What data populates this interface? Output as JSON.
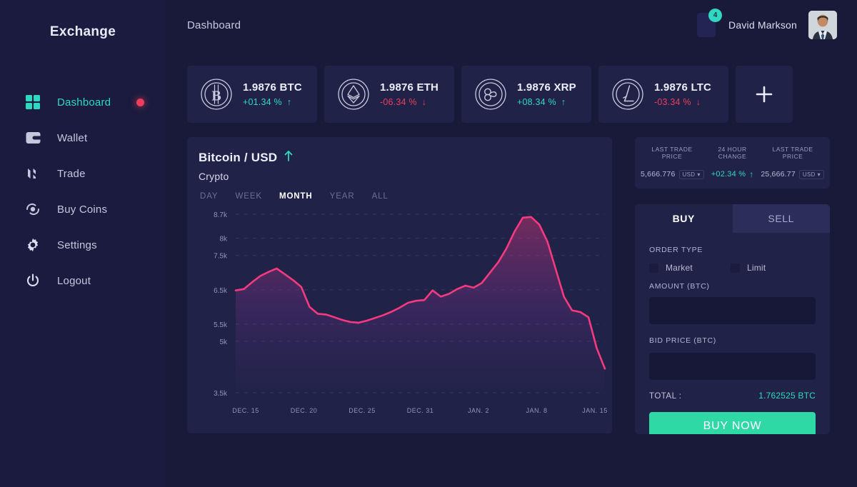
{
  "brand": "Exchange",
  "sidebar": {
    "items": [
      {
        "label": "Dashboard",
        "icon": "grid-icon",
        "active": true,
        "badge": true
      },
      {
        "label": "Wallet",
        "icon": "wallet-icon",
        "active": false,
        "badge": false
      },
      {
        "label": "Trade",
        "icon": "trade-icon",
        "active": false,
        "badge": false
      },
      {
        "label": "Buy Coins",
        "icon": "buy-coins-icon",
        "active": false,
        "badge": false
      },
      {
        "label": "Settings",
        "icon": "gear-icon",
        "active": false,
        "badge": false
      },
      {
        "label": "Logout",
        "icon": "power-icon",
        "active": false,
        "badge": false
      }
    ]
  },
  "topbar": {
    "breadcrumb": "Dashboard",
    "notification_count": "4",
    "user_name": "David Markson"
  },
  "tickers": [
    {
      "amount": "1.9876 BTC",
      "change": "+01.34 %",
      "direction": "up",
      "icon": "bitcoin-icon"
    },
    {
      "amount": "1.9876 ETH",
      "change": "-06.34 %",
      "direction": "down",
      "icon": "ethereum-icon"
    },
    {
      "amount": "1.9876 XRP",
      "change": "+08.34 %",
      "direction": "up",
      "icon": "ripple-icon"
    },
    {
      "amount": "1.9876 LTC",
      "change": "-03.34 %",
      "direction": "down",
      "icon": "litecoin-icon"
    }
  ],
  "add_card_label": "+",
  "chart_panel": {
    "title": "Bitcoin / USD",
    "trend": "up",
    "subtitle": "Crypto",
    "tabs": [
      {
        "label": "DAY",
        "active": false
      },
      {
        "label": "WEEK",
        "active": false
      },
      {
        "label": "MONTH",
        "active": true
      },
      {
        "label": "YEAR",
        "active": false
      },
      {
        "label": "ALL",
        "active": false
      }
    ]
  },
  "chart_data": {
    "type": "line",
    "title": "Bitcoin / USD",
    "subtitle": "Crypto",
    "xlabel": "",
    "ylabel": "",
    "grid": true,
    "legend": false,
    "line_color": "#f63a7f",
    "fill": "gradient-magenta-transparent",
    "ylim": [
      3500,
      8700
    ],
    "ytick_labels": [
      "8.7k",
      "8k",
      "7.5k",
      "6.5k",
      "5.5k",
      "5k",
      "3.5k"
    ],
    "ytick_values": [
      8700,
      8000,
      7500,
      6500,
      5500,
      5000,
      3500
    ],
    "xtick_labels": [
      "DEC. 15",
      "DEC. 20",
      "DEC. 25",
      "DEC. 31",
      "JAN. 2",
      "JAN. 8",
      "JAN. 15"
    ],
    "x": [
      0,
      1,
      2,
      3,
      4,
      5,
      6,
      7,
      8,
      9,
      10,
      11,
      12,
      13,
      14,
      15,
      16,
      17,
      18,
      19,
      20,
      21,
      22,
      23,
      24,
      25,
      26,
      27,
      28,
      29,
      30,
      31,
      32,
      33,
      34,
      35,
      36,
      37,
      38
    ],
    "values": [
      6480,
      6520,
      6720,
      6900,
      7020,
      7120,
      6950,
      6780,
      6580,
      6000,
      5800,
      5780,
      5700,
      5620,
      5560,
      5540,
      5600,
      5680,
      5760,
      5860,
      5980,
      6120,
      6180,
      6200,
      6480,
      6300,
      6380,
      6520,
      6620,
      6560,
      6700,
      7000,
      7300,
      7700,
      8200,
      8600,
      8620,
      8400,
      7900,
      7100,
      6300,
      5900,
      5850,
      5700,
      4800,
      4200
    ]
  },
  "price_panel": {
    "columns": [
      {
        "header": "LAST TRADE PRICE",
        "value": "5,666.776",
        "currency": "USD"
      },
      {
        "header": "24 HOUR CHANGE",
        "value": "+02.34 %",
        "direction": "up"
      },
      {
        "header": "LAST TRADE PRICE",
        "value": "25,666.77",
        "currency": "USD"
      }
    ]
  },
  "order_form": {
    "tabs": [
      {
        "label": "BUY",
        "active": true
      },
      {
        "label": "SELL",
        "active": false
      }
    ],
    "order_type_label": "ORDER TYPE",
    "order_types": [
      {
        "label": "Market",
        "checked": false
      },
      {
        "label": "Limit",
        "checked": false
      }
    ],
    "amount_label": "AMOUNT (BTC)",
    "amount_value": "",
    "amount_placeholder": "",
    "bid_price_label": "BID PRICE (BTC)",
    "bid_price_value": "",
    "bid_price_placeholder": "",
    "total_label": "TOTAL :",
    "total_value": "1.762525 BTC",
    "submit_label": "BUY NOW"
  }
}
